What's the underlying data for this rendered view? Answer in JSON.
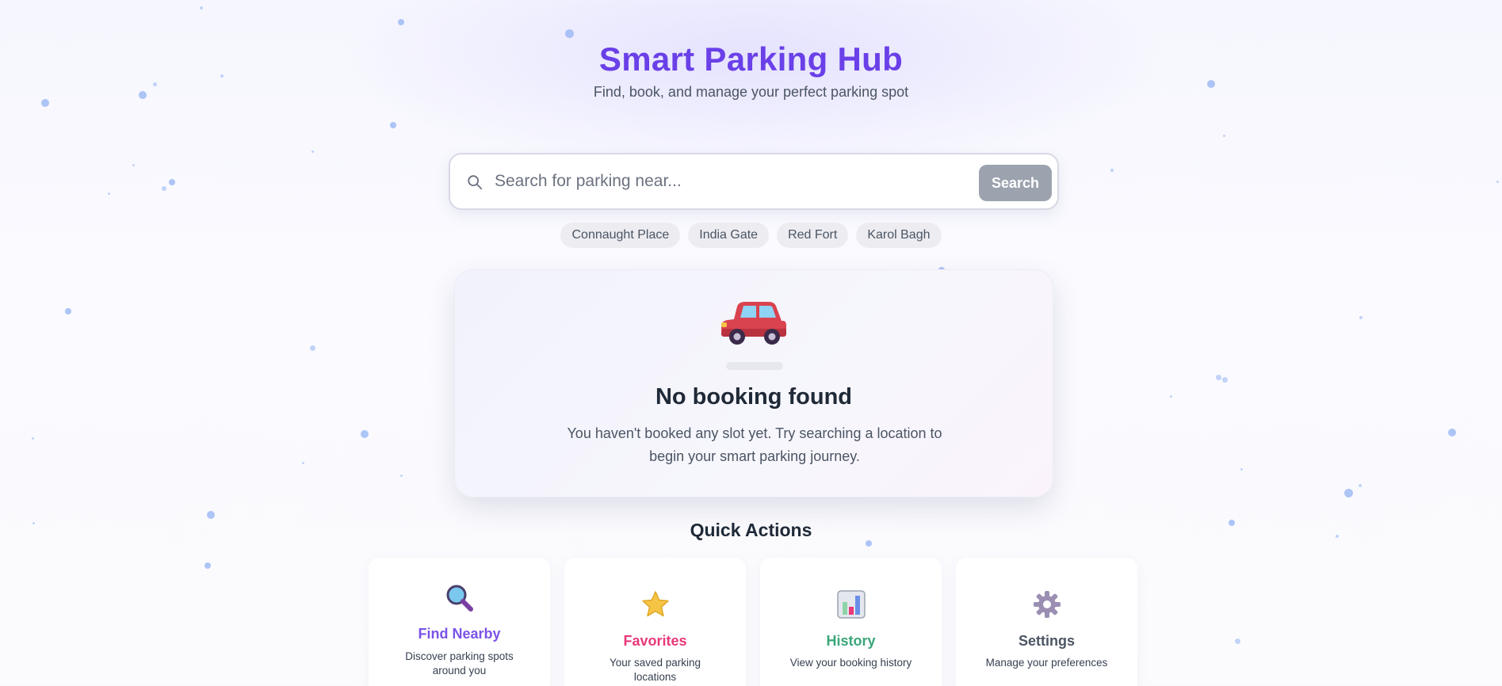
{
  "header": {
    "title": "Smart Parking Hub",
    "subtitle": "Find, book, and manage your perfect parking spot"
  },
  "search": {
    "placeholder": "Search for parking near...",
    "value": "",
    "button_label": "Search",
    "icon": "search-icon"
  },
  "chips": [
    "Connaught Place",
    "India Gate",
    "Red Fort",
    "Karol Bagh"
  ],
  "empty_state": {
    "icon": "car-icon",
    "title": "No booking found",
    "message": "You haven't booked any slot yet. Try searching a location to begin your smart parking journey."
  },
  "quick_actions": {
    "title": "Quick Actions",
    "items": [
      {
        "icon": "magnifier-icon",
        "title": "Find Nearby",
        "description": "Discover parking spots around you",
        "color": "#7b53e6"
      },
      {
        "icon": "star-icon",
        "title": "Favorites",
        "description": "Your saved parking locations",
        "color": "#e8397a"
      },
      {
        "icon": "bar-chart-icon",
        "title": "History",
        "description": "View your booking history",
        "color": "#3aa67a"
      },
      {
        "icon": "gear-icon",
        "title": "Settings",
        "description": "Manage your preferences",
        "color": "#4b5563"
      }
    ]
  },
  "colors": {
    "title": "#6a40e8",
    "search_button": "#9ca3af",
    "particle": "#93b3f3"
  }
}
